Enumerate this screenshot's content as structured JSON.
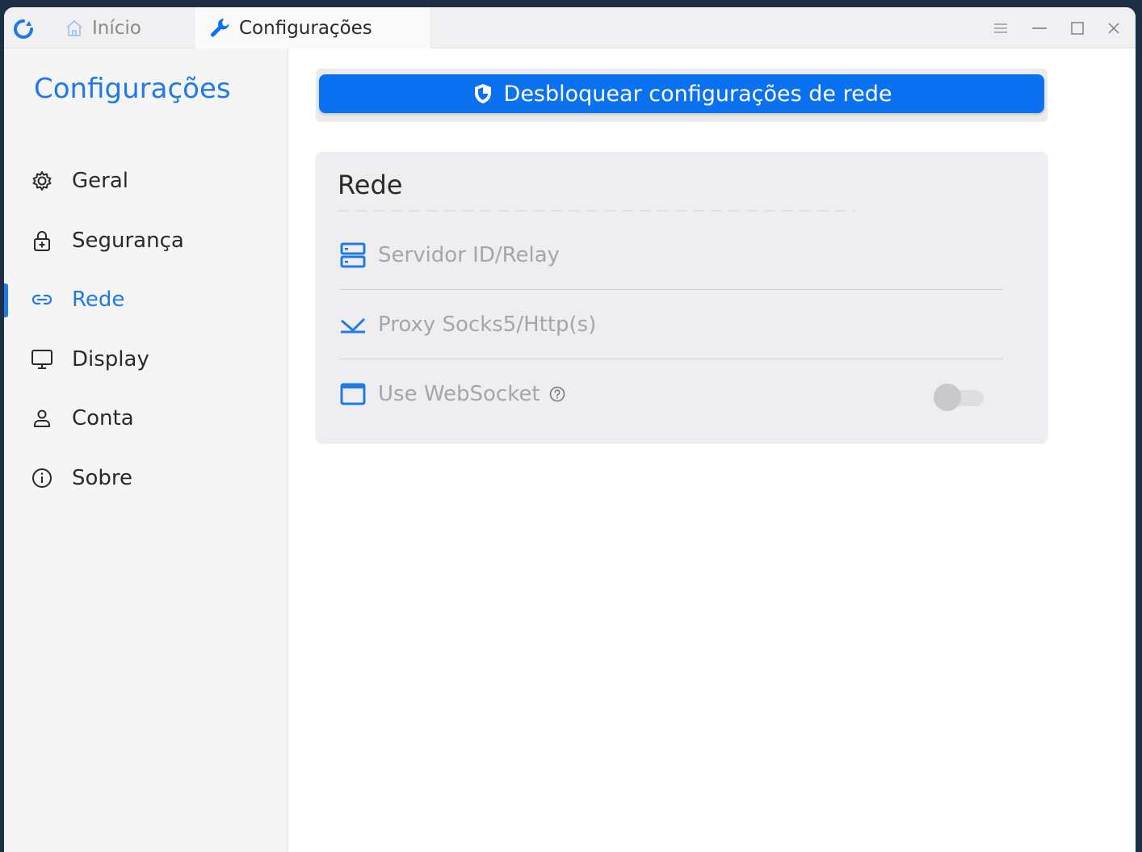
{
  "titlebar": {
    "tabs": [
      {
        "label": "Início",
        "icon": "home-icon"
      },
      {
        "label": "Configurações",
        "icon": "wrench-icon"
      }
    ],
    "controls": [
      "menu-icon",
      "minimize-icon",
      "maximize-icon",
      "close-icon"
    ]
  },
  "sidebar": {
    "title": "Configurações",
    "items": [
      {
        "label": "Geral",
        "icon": "gear-icon"
      },
      {
        "label": "Segurança",
        "icon": "lock-icon"
      },
      {
        "label": "Rede",
        "icon": "link-icon",
        "active": true
      },
      {
        "label": "Display",
        "icon": "monitor-icon"
      },
      {
        "label": "Conta",
        "icon": "user-icon"
      },
      {
        "label": "Sobre",
        "icon": "info-icon"
      }
    ]
  },
  "main": {
    "unlock_button": "Desbloquear configurações de rede",
    "card": {
      "title": "Rede",
      "rows": [
        {
          "label": "Servidor ID/Relay",
          "icon": "server-icon"
        },
        {
          "label": "Proxy Socks5/Http(s)",
          "icon": "proxy-icon"
        },
        {
          "label": "Use WebSocket",
          "icon": "window-icon",
          "toggle": false
        }
      ]
    }
  },
  "colors": {
    "accent": "#1f7ae8",
    "button": "#0a72f0",
    "disabled_text": "#a6a6aa"
  }
}
